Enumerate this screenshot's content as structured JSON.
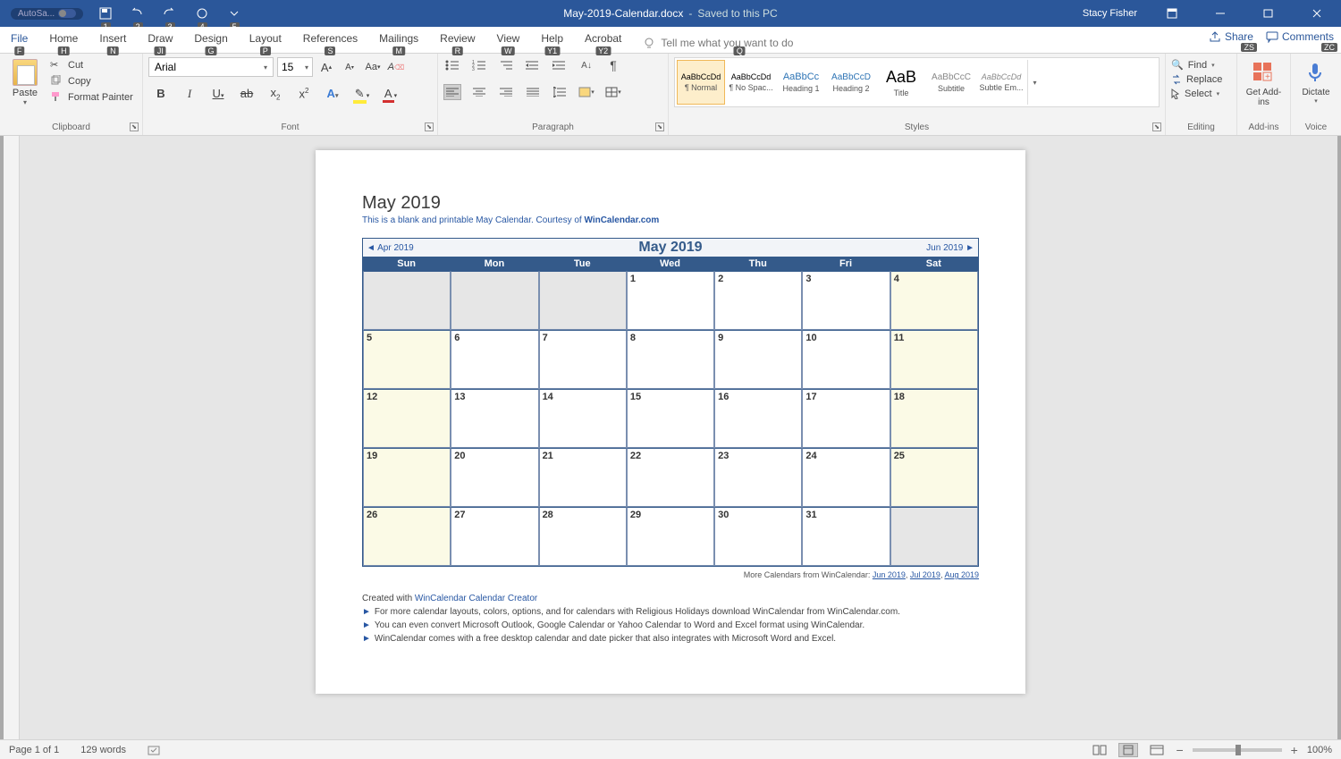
{
  "titlebar": {
    "autosave": "AutoSa...",
    "doc_name": "May-2019-Calendar.docx",
    "saved_status": "Saved to this PC",
    "user": "Stacy Fisher",
    "qat_keys": [
      "1",
      "2",
      "3",
      "4",
      "5"
    ]
  },
  "tabs": {
    "file": "File",
    "list": [
      "Home",
      "Insert",
      "Draw",
      "Design",
      "Layout",
      "References",
      "Mailings",
      "Review",
      "View",
      "Help",
      "Acrobat"
    ],
    "keys": [
      "H",
      "N",
      "JI",
      "G",
      "P",
      "S",
      "M",
      "R",
      "W",
      "Y1",
      "Y2"
    ],
    "file_key": "F",
    "tell_me": "Tell me what you want to do",
    "tell_key": "Q",
    "share": "Share",
    "share_key": "ZS",
    "comments": "Comments",
    "comments_key": "ZC"
  },
  "ribbon": {
    "clipboard": {
      "label": "Clipboard",
      "paste": "Paste",
      "cut": "Cut",
      "copy": "Copy",
      "format_painter": "Format Painter"
    },
    "font": {
      "label": "Font",
      "name": "Arial",
      "size": "15"
    },
    "paragraph": {
      "label": "Paragraph"
    },
    "styles": {
      "label": "Styles",
      "items": [
        {
          "sample": "AaBbCcDd",
          "name": "¶ Normal",
          "sel": true,
          "color": "#000",
          "size": "9px"
        },
        {
          "sample": "AaBbCcDd",
          "name": "¶ No Spac...",
          "color": "#000",
          "size": "9px"
        },
        {
          "sample": "AaBbCc",
          "name": "Heading 1",
          "color": "#2e74b5",
          "size": "11px"
        },
        {
          "sample": "AaBbCcD",
          "name": "Heading 2",
          "color": "#2e74b5",
          "size": "10px"
        },
        {
          "sample": "AaB",
          "name": "Title",
          "color": "#000",
          "size": "18px"
        },
        {
          "sample": "AaBbCcC",
          "name": "Subtitle",
          "color": "#888",
          "size": "10px"
        },
        {
          "sample": "AaBbCcDd",
          "name": "Subtle Em...",
          "color": "#888",
          "size": "9px",
          "italic": true
        }
      ]
    },
    "editing": {
      "label": "Editing",
      "find": "Find",
      "replace": "Replace",
      "select": "Select"
    },
    "addins": {
      "label": "Add-ins",
      "get": "Get Add-ins"
    },
    "voice": {
      "label": "Voice",
      "dictate": "Dictate"
    }
  },
  "document": {
    "title": "May 2019",
    "subtitle_pre": "This is a blank and printable May Calendar.  Courtesy of ",
    "subtitle_link": "WinCalendar.com",
    "cal_header": "May  2019",
    "prev_month": "◄ Apr 2019",
    "next_month": "Jun 2019 ►",
    "day_names": [
      "Sun",
      "Mon",
      "Tue",
      "Wed",
      "Thu",
      "Fri",
      "Sat"
    ],
    "weeks": [
      [
        {
          "n": "",
          "pad": true
        },
        {
          "n": "",
          "pad": true
        },
        {
          "n": "",
          "pad": true
        },
        {
          "n": "1"
        },
        {
          "n": "2"
        },
        {
          "n": "3"
        },
        {
          "n": "4",
          "w": true
        }
      ],
      [
        {
          "n": "5",
          "w": true
        },
        {
          "n": "6"
        },
        {
          "n": "7"
        },
        {
          "n": "8"
        },
        {
          "n": "9"
        },
        {
          "n": "10"
        },
        {
          "n": "11",
          "w": true
        }
      ],
      [
        {
          "n": "12",
          "w": true
        },
        {
          "n": "13"
        },
        {
          "n": "14"
        },
        {
          "n": "15"
        },
        {
          "n": "16"
        },
        {
          "n": "17"
        },
        {
          "n": "18",
          "w": true
        }
      ],
      [
        {
          "n": "19",
          "w": true
        },
        {
          "n": "20"
        },
        {
          "n": "21"
        },
        {
          "n": "22"
        },
        {
          "n": "23"
        },
        {
          "n": "24"
        },
        {
          "n": "25",
          "w": true
        }
      ],
      [
        {
          "n": "26",
          "w": true
        },
        {
          "n": "27"
        },
        {
          "n": "28"
        },
        {
          "n": "29"
        },
        {
          "n": "30"
        },
        {
          "n": "31"
        },
        {
          "n": "",
          "pad": true
        }
      ]
    ],
    "more_pre": "More Calendars from WinCalendar: ",
    "more_links": [
      "Jun 2019",
      "Jul 2019",
      "Aug 2019"
    ],
    "created_pre": "Created with ",
    "created_link": "WinCalendar Calendar Creator",
    "bullets": [
      "For more calendar layouts, colors, options, and for calendars with Religious Holidays download WinCalendar from WinCalendar.com.",
      "You can even convert Microsoft Outlook, Google Calendar or Yahoo Calendar to Word and Excel format using WinCalendar.",
      "WinCalendar comes with a free desktop calendar and date picker that also integrates with Microsoft Word and Excel."
    ]
  },
  "status": {
    "page": "Page 1 of 1",
    "words": "129 words",
    "zoom": "100%"
  }
}
